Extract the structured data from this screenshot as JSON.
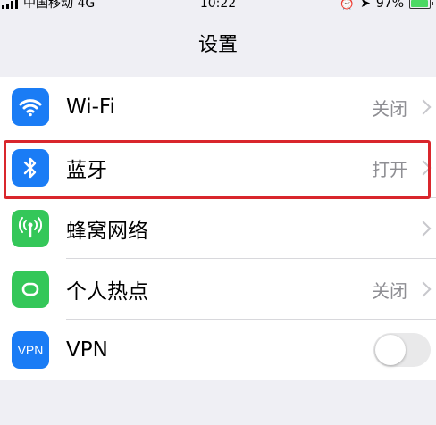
{
  "status_bar": {
    "carrier": "中国移动 4G",
    "time": "10:22",
    "battery": "97%",
    "battery_level": 0.97
  },
  "nav": {
    "title": "设置"
  },
  "rows": [
    {
      "label": "Wi-Fi",
      "value": "关闭",
      "icon": "wifi-icon",
      "color": "#1a7cf5"
    },
    {
      "label": "蓝牙",
      "value": "打开",
      "icon": "bluetooth-icon",
      "color": "#1a7cf5"
    },
    {
      "label": "蜂窝网络",
      "value": "",
      "icon": "cellular-icon",
      "color": "#34c759"
    },
    {
      "label": "个人热点",
      "value": "关闭",
      "icon": "hotspot-icon",
      "color": "#34c759"
    },
    {
      "label": "VPN",
      "value": "",
      "icon": "vpn-icon",
      "color": "#1a7cf5",
      "icon_text": "VPN",
      "toggle_on": false
    }
  ],
  "colors": {
    "highlight": "#d9262c",
    "background": "#efeff4"
  }
}
